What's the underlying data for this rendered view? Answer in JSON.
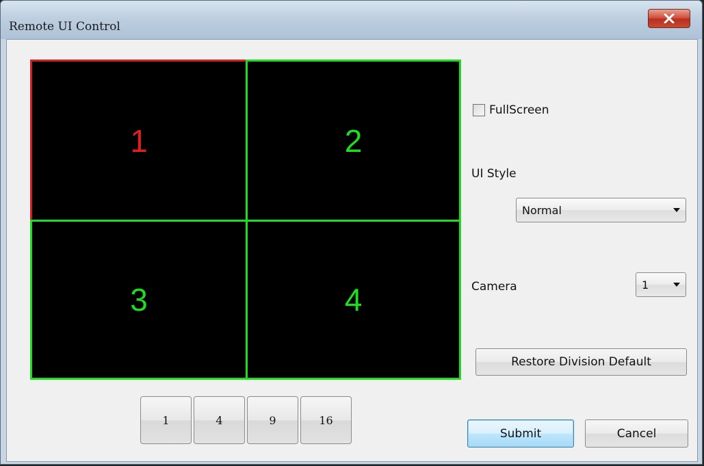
{
  "window": {
    "title": "Remote UI Control",
    "close_icon": "close-icon"
  },
  "grid": {
    "cells": [
      {
        "label": "1",
        "selected": true,
        "color": "#e02020"
      },
      {
        "label": "2",
        "selected": false,
        "color": "#1edc1e"
      },
      {
        "label": "3",
        "selected": false,
        "color": "#1edc1e"
      },
      {
        "label": "4",
        "selected": false,
        "color": "#1edc1e"
      }
    ]
  },
  "division_buttons": [
    "1",
    "4",
    "9",
    "16"
  ],
  "options": {
    "fullscreen_label": "FullScreen",
    "fullscreen_checked": false,
    "ui_style_label": "UI Style",
    "ui_style_value": "Normal",
    "camera_label": "Camera",
    "camera_value": "1"
  },
  "buttons": {
    "restore": "Restore Division Default",
    "submit": "Submit",
    "cancel": "Cancel"
  },
  "colors": {
    "active_border": "#d02020",
    "inactive_border": "#1edc1e",
    "focus_button": "#3c7fb1"
  }
}
